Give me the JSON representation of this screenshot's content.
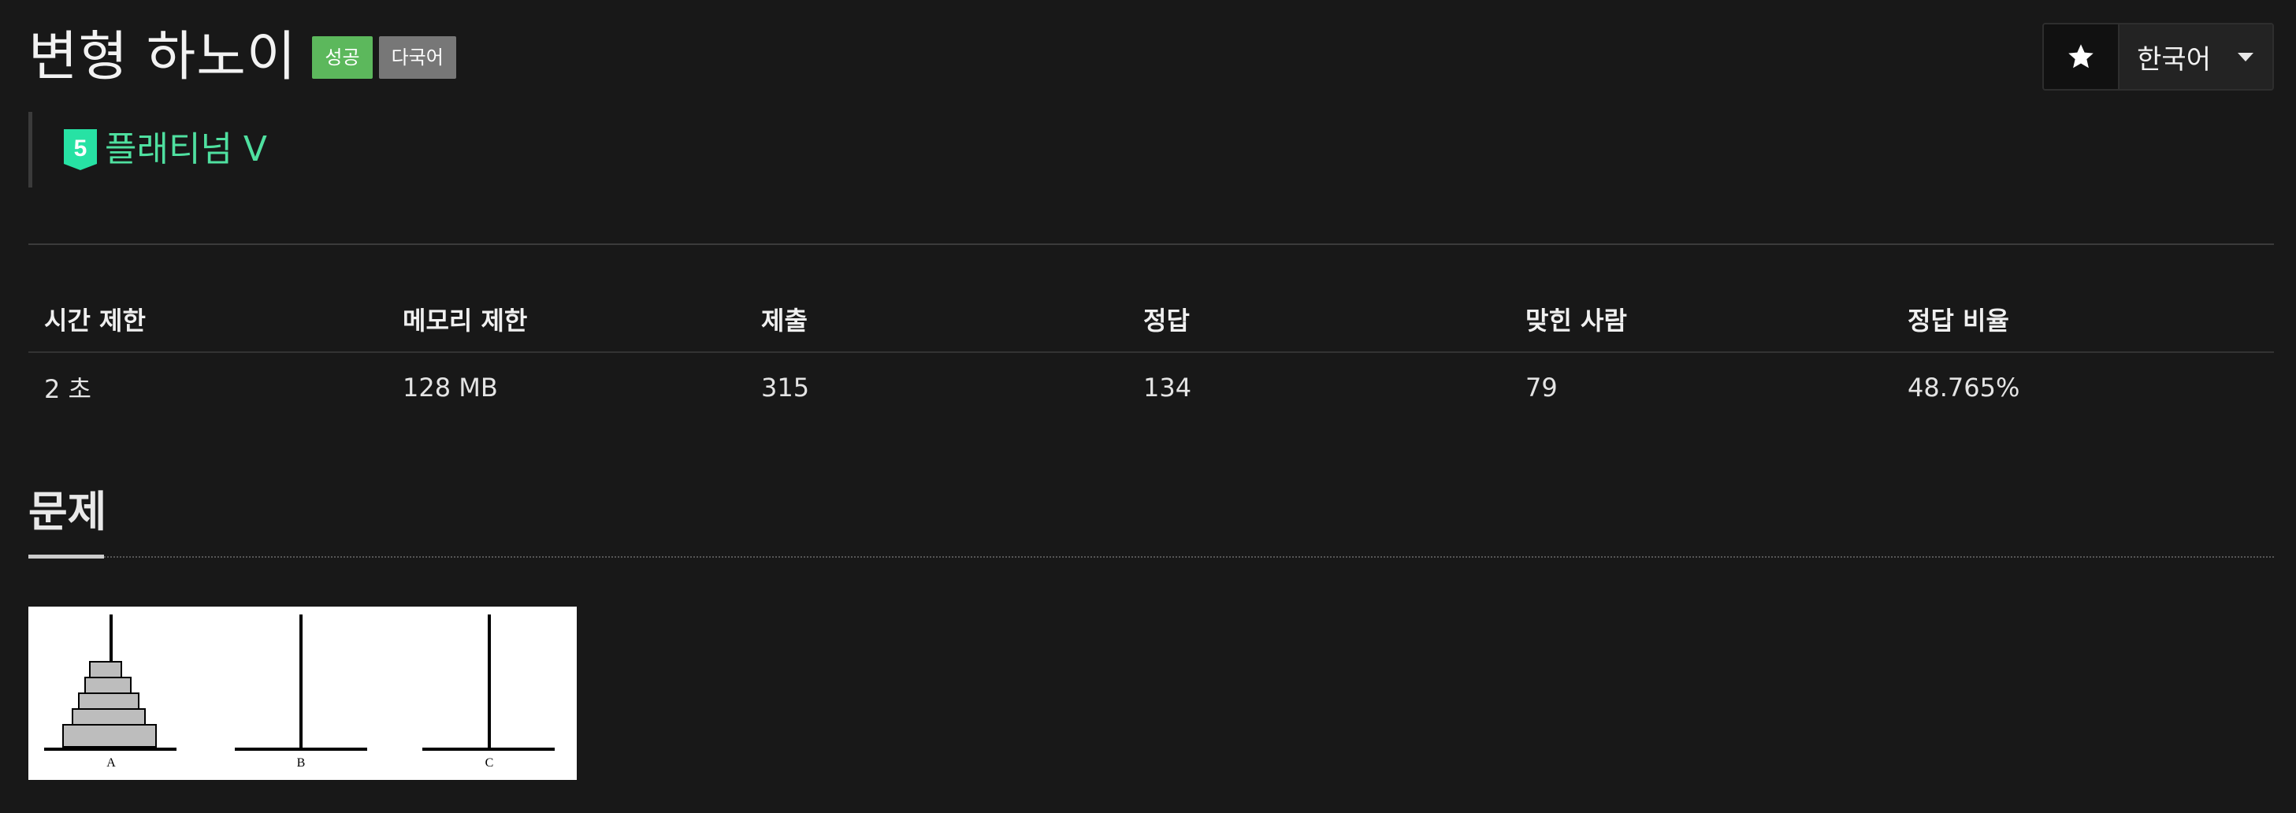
{
  "problem": {
    "title": "변형 하노이",
    "badges": {
      "success": "성공",
      "multilang": "다국어"
    },
    "tier": {
      "icon": "platinum-tier-icon",
      "number": "5",
      "label": "플래티넘 V",
      "color": "#4fe0a0"
    }
  },
  "toolbar": {
    "star_icon": "star-icon",
    "language": "한국어",
    "dropdown_icon": "caret-down-icon"
  },
  "stats": {
    "headers": [
      "시간 제한",
      "메모리 제한",
      "제출",
      "정답",
      "맞힌 사람",
      "정답 비율"
    ],
    "values": [
      "2 초",
      "128 MB",
      "315",
      "134",
      "79",
      "48.765%"
    ]
  },
  "section": {
    "title": "문제"
  },
  "figure": {
    "peg_labels": [
      "A",
      "B",
      "C"
    ]
  },
  "colors": {
    "background": "#181818",
    "success": "#5cb85c",
    "badge_gray": "#777777"
  }
}
